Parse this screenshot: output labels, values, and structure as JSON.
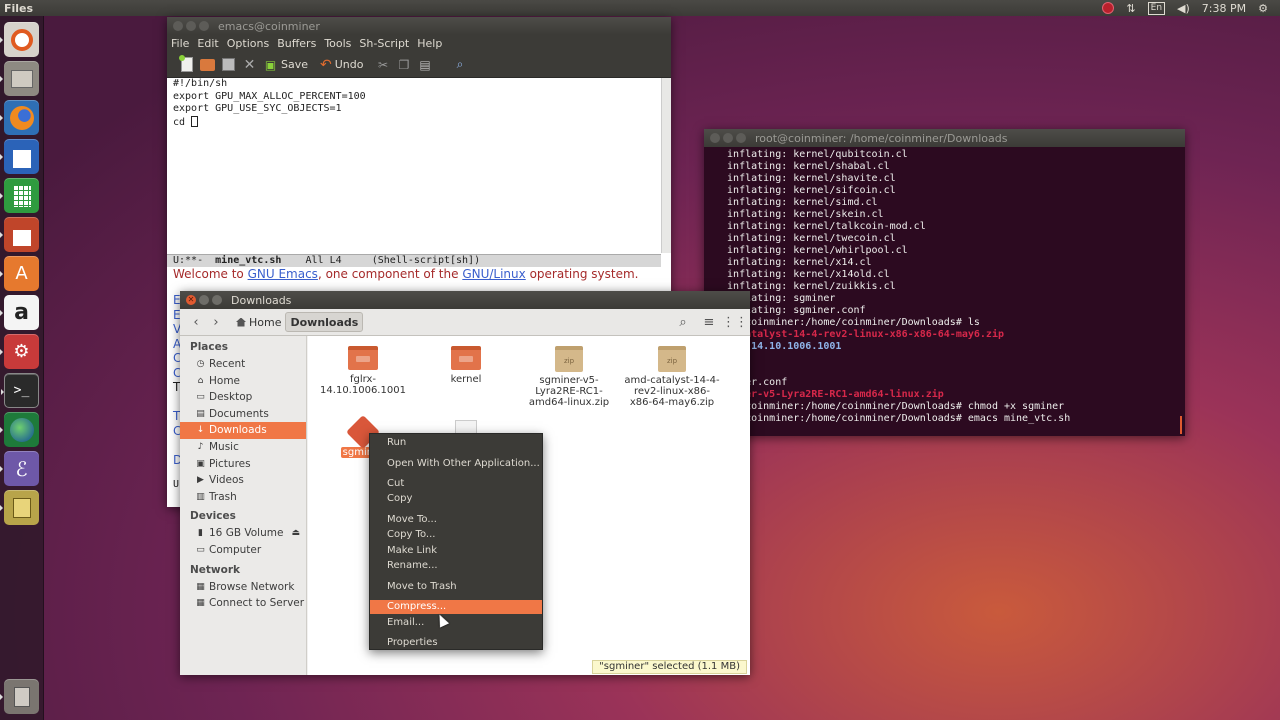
{
  "top_panel": {
    "app_name": "Files",
    "lang": "En",
    "time": "7:38 PM"
  },
  "launcher": {
    "items": [
      "ubuntu-dash-icon",
      "files-icon",
      "firefox-icon",
      "writer-icon",
      "calc-icon",
      "impress-icon",
      "software-center-icon",
      "amazon-icon",
      "settings-icon",
      "terminal-icon",
      "globe-icon",
      "emacs-icon",
      "archive-icon",
      "trash-icon"
    ],
    "amazon_glyph": "a",
    "software_glyph": "A"
  },
  "emacs": {
    "title": "emacs@coinminer",
    "menu": [
      "File",
      "Edit",
      "Options",
      "Buffers",
      "Tools",
      "Sh-Script",
      "Help"
    ],
    "toolbar": {
      "save": "Save",
      "undo": "Undo"
    },
    "lines": [
      "#!/bin/sh",
      "export GPU_MAX_ALLOC_PERCENT=100",
      "export GPU_USE_SYC_OBJECTS=1",
      "cd "
    ],
    "modeline": {
      "status": "U:**-",
      "buffer": "mine_vtc.sh",
      "pos": "All L4",
      "mode": "(Shell-script[sh])"
    },
    "welcome": {
      "prefix": "Welcome to ",
      "gnu_emacs": "GNU Emacs",
      "middle": ", one component of the ",
      "gnu_linux": "GNU/Linux",
      "suffix": " operating system."
    },
    "left_edge_letters": [
      "E",
      "E",
      "V",
      "A",
      "C",
      "C",
      "T",
      "",
      "T",
      "C",
      "",
      "D"
    ],
    "bottom_left": "U"
  },
  "terminal": {
    "title": "root@coinminer: /home/coinminer/Downloads",
    "lines": [
      {
        "t": "  inflating: kernel/qubitcoin.cl"
      },
      {
        "t": "  inflating: kernel/shabal.cl"
      },
      {
        "t": "  inflating: kernel/shavite.cl"
      },
      {
        "t": "  inflating: kernel/sifcoin.cl"
      },
      {
        "t": "  inflating: kernel/simd.cl"
      },
      {
        "t": "  inflating: kernel/skein.cl"
      },
      {
        "t": "  inflating: kernel/talkcoin-mod.cl"
      },
      {
        "t": "  inflating: kernel/twecoin.cl"
      },
      {
        "t": "  inflating: kernel/whirlpool.cl"
      },
      {
        "t": "  inflating: kernel/x14.cl"
      },
      {
        "t": "  inflating: kernel/x14old.cl"
      },
      {
        "t": "  inflating: kernel/zuikkis.cl"
      },
      {
        "t": "  inflating: sgminer"
      },
      {
        "t": "  inflating: sgminer.conf"
      },
      {
        "t": "root@coinminer:/home/coinminer/Downloads# ls"
      },
      {
        "t": "amd-catalyst-14-4-rev2-linux-x86-x86-64-may6.zip",
        "c": "red"
      },
      {
        "t": "fglrx-14.10.1006.1001",
        "c": "blue"
      },
      {
        "t": ""
      },
      {
        "t": ""
      },
      {
        "t": "sgminer.conf"
      },
      {
        "t": "sgminer-v5-Lyra2RE-RC1-amd64-linux.zip",
        "c": "red"
      },
      {
        "t": "root@coinminer:/home/coinminer/Downloads# chmod +x sgminer"
      },
      {
        "t": "root@coinminer:/home/coinminer/Downloads# emacs mine_vtc.sh"
      }
    ]
  },
  "files": {
    "title": "Downloads",
    "breadcrumb": {
      "home": "Home",
      "current": "Downloads"
    },
    "sidebar": {
      "places_head": "Places",
      "places": [
        {
          "label": "Recent",
          "icon": "◷"
        },
        {
          "label": "Home",
          "icon": "⌂"
        },
        {
          "label": "Desktop",
          "icon": "▭"
        },
        {
          "label": "Documents",
          "icon": "▤"
        },
        {
          "label": "Downloads",
          "icon": "↓",
          "active": true
        },
        {
          "label": "Music",
          "icon": "♪"
        },
        {
          "label": "Pictures",
          "icon": "▣"
        },
        {
          "label": "Videos",
          "icon": "▶"
        },
        {
          "label": "Trash",
          "icon": "▥"
        }
      ],
      "devices_head": "Devices",
      "devices": [
        {
          "label": "16 GB Volume",
          "icon": "▮",
          "eject": "⏏"
        },
        {
          "label": "Computer",
          "icon": "▭"
        }
      ],
      "network_head": "Network",
      "network": [
        {
          "label": "Browse Network",
          "icon": "▦"
        },
        {
          "label": "Connect to Server",
          "icon": "▦"
        }
      ]
    },
    "items": [
      {
        "name": "fglrx-14.10.1006.1001",
        "type": "folder"
      },
      {
        "name": "kernel",
        "type": "folder"
      },
      {
        "name": "sgminer-v5-Lyra2RE-RC1-amd64-linux.zip",
        "type": "zip"
      },
      {
        "name": "amd-catalyst-14-4-rev2-linux-x86-x86-64-may6.zip",
        "type": "zip"
      },
      {
        "name": "sgminer",
        "type": "exe",
        "selected": true
      },
      {
        "name": "",
        "type": "blank"
      }
    ],
    "status": "\"sgminer\" selected  (1.1 MB)"
  },
  "context_menu": {
    "items": [
      {
        "label": "Run"
      },
      {
        "label": "Open With Other Application..."
      },
      {
        "label": "Cut"
      },
      {
        "label": "Copy"
      },
      {
        "label": "Move To..."
      },
      {
        "label": "Copy To..."
      },
      {
        "label": "Make Link"
      },
      {
        "label": "Rename..."
      },
      {
        "label": "Move to Trash"
      },
      {
        "label": "Compress...",
        "hover": true
      },
      {
        "label": "Email..."
      },
      {
        "label": "Properties"
      }
    ]
  },
  "colors": {
    "accent": "#f07746",
    "panel": "#3c3b37",
    "terminal_bg": "#2c0a20"
  }
}
